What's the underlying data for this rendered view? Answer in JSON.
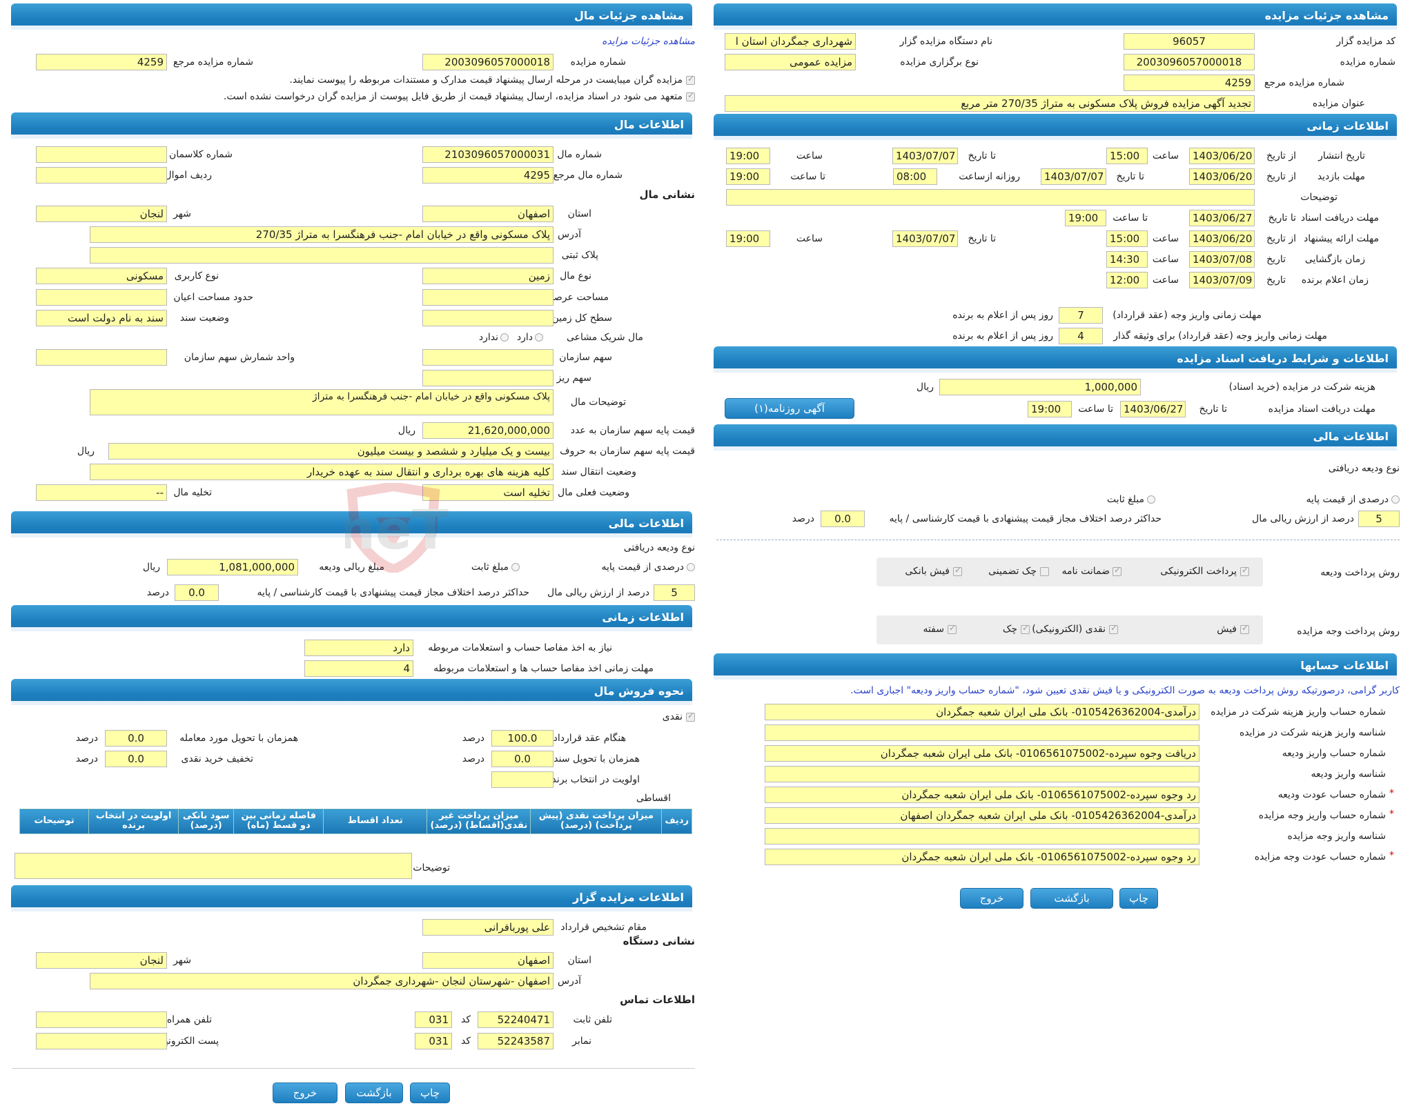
{
  "right": {
    "title": "مشاهده جزئیات مزایده",
    "fields": {
      "auctioneer_code_label": "کد مزایده گزار",
      "auctioneer_code": "96057",
      "auctioneer_name_label": "نام دستگاه مزایده گزار",
      "auctioneer_name": "شهرداری جمگردان استان ا",
      "auction_no_label": "شماره مزایده",
      "auction_no": "2003096057000018",
      "holding_type_label": "نوع برگزاری مزایده",
      "holding_type": "مزایده عمومی",
      "ref_no_label": "شماره مزایده مرجع",
      "ref_no": "4259",
      "auction_title_label": "عنوان مزایده",
      "auction_title": "تجدید آگهی مزایده فروش پلاک مسکونی به متراژ 270/35 متر مربع"
    },
    "time": {
      "title": "اطلاعات زمانی",
      "publish_label": "تاریخ انتشار",
      "from_date": "از تاریخ",
      "to_date": "تا تاریخ",
      "hour": "ساعت",
      "to_hour": "تا ساعت",
      "publish_from": "1403/06/20",
      "publish_from_time": "15:00",
      "publish_to": "1403/07/07",
      "publish_to_time": "19:00",
      "visit_label": "مهلت بازدید",
      "visit_from": "1403/06/20",
      "visit_to": "1403/07/07",
      "daily_from_label": "روزانه ازساعت",
      "visit_daily_from": "08:00",
      "visit_daily_to": "19:00",
      "desc_label": "توضیحات",
      "desc": "",
      "docs_label": "مهلت دریافت اسناد",
      "docs_to": "1403/06/27",
      "docs_to_time": "19:00",
      "offer_label": "مهلت ارائه پیشنهاد",
      "offer_from": "1403/06/20",
      "offer_from_time": "15:00",
      "offer_to": "1403/07/07",
      "offer_to_time": "19:00",
      "open_label": "زمان بازگشایی",
      "date_label": "تاریخ",
      "open_date": "1403/07/08",
      "open_time": "14:30",
      "winner_label": "زمان اعلام برنده",
      "winner_date": "1403/07/09",
      "winner_time": "12:00",
      "pay_deadline_label": "مهلت زمانی واریز وجه (عقد قرارداد)",
      "pay_deadline": "7",
      "days_after": "روز پس از اعلام به برنده",
      "bond_deadline_label": "مهلت زمانی واریز وجه (عقد قرارداد) برای وثیقه گذار",
      "bond_deadline": "4"
    },
    "docs": {
      "title": "اطلاعات و شرایط دریافت اسناد مزایده",
      "fee_label": "هزینه شرکت در مزایده (خرید اسناد)",
      "fee": "1,000,000",
      "rial": "ریال",
      "deadline_label": "مهلت دریافت اسناد مزایده",
      "to_date": "تا تاریخ",
      "deadline_date": "1403/06/27",
      "to_hour": "تا ساعت",
      "deadline_time": "19:00",
      "newspaper_btn": "آگهی روزنامه(۱)"
    },
    "finance": {
      "title": "اطلاعات مالی",
      "deposit_type_label": "نوع ودیعه دریافتی",
      "percent_opt": "درصدی از قیمت پایه",
      "fixed_opt": "مبلغ ثابت",
      "pct_label": "درصد از ارزش ریالی مال",
      "pct": "5",
      "diff_label": "حداکثر درصد اختلاف مجاز قیمت پیشنهادی با قیمت کارشناسی / پایه",
      "diff": "0.0",
      "percent_word": "درصد",
      "deposit_pay_label": "روش پرداخت ودیعه",
      "deposit_methods": [
        "پرداخت الکترونیکی",
        "ضمانت نامه",
        "چک تضمینی",
        "فیش بانکی"
      ],
      "price_pay_label": "روش پرداخت وجه مزایده",
      "price_methods": [
        "فیش",
        "نقدی (الکترونیکی)",
        "چک",
        "سفته"
      ]
    },
    "accounts": {
      "title": "اطلاعات حسابها",
      "note": "کاربر گرامی، درصورتیکه روش پرداخت ودیعه به صورت الکترونیکی و یا فیش نقدی تعیین شود، \"شماره حساب واریز ودیعه\" اجباری است.",
      "rows": [
        {
          "label": "شماره حساب واریز هزینه شرکت در مزایده",
          "value": "درآمدی-0105426362004- بانک ملی ایران شعبه جمگردان",
          "req": ""
        },
        {
          "label": "شناسه واریز هزینه شرکت در مزایده",
          "value": "",
          "req": ""
        },
        {
          "label": "شماره حساب واریز ودیعه",
          "value": "دریافت وجوه سپرده-0106561075002- بانک ملی ایران شعبه جمگردان",
          "req": ""
        },
        {
          "label": "شناسه واریز ودیعه",
          "value": "",
          "req": ""
        },
        {
          "label": "شماره حساب عودت ودیعه",
          "value": "رد وجوه سپرده-0106561075002- بانک ملی ایران شعبه جمگردان",
          "req": "*"
        },
        {
          "label": "شماره حساب واریز وجه مزایده",
          "value": "درآمدی-0105426362004- بانک ملی ایران شعبه جمگردان اصفهان",
          "req": "*"
        },
        {
          "label": "شناسه واریز وجه مزایده",
          "value": "",
          "req": ""
        },
        {
          "label": "شماره حساب عودت وجه مزایده",
          "value": "رد وجوه سپرده-0106561075002- بانک ملی ایران شعبه جمگردان",
          "req": "*"
        }
      ]
    },
    "buttons": {
      "print": "چاپ",
      "back": "بازگشت",
      "exit": "خروج"
    }
  },
  "left": {
    "title": "مشاهده جزئیات مال",
    "link": "مشاهده جزئیات مزایده",
    "auction_no_label": "شماره مزایده",
    "auction_no": "2003096057000018",
    "ref_no_label": "شماره مزایده مرجع",
    "ref_no": "4259",
    "check1": "مزایده گران میبایست در مرحله ارسال پیشنهاد قیمت مدارک و مستندات مربوطه را پیوست نمایند.",
    "check2": "متعهد می شود در اسناد مزایده، ارسال پیشنهاد قیمت از طریق فایل پیوست از مزایده گران درخواست نشده است.",
    "asset": {
      "title": "اطلاعات مال",
      "asset_no_label": "شماره مال",
      "asset_no": "2103096057000031",
      "class_no_label": "شماره کلاسمان",
      "class_no": "",
      "ref_asset_label": "شماره مال مرجع",
      "ref_asset": "4295",
      "row_label": "ردیف اموال",
      "row": "",
      "address_head": "نشانی مال",
      "province_label": "استان",
      "province": "اصفهان",
      "city_label": "شهر",
      "city": "لنجان",
      "address_label": "آدرس",
      "address": "پلاک مسکونی واقع در خیابان امام -جنب فرهنگسرا به متراژ 270/35",
      "plate_label": "پلاک ثبتی",
      "plate": "",
      "type_label": "نوع مال",
      "type": "زمین",
      "use_label": "نوع کاربری",
      "use": "مسکونی",
      "area_label": "مساحت عرصه",
      "area": "",
      "building_label": "حدود مساحت اعیان",
      "building": "",
      "level_label": "سطح کل زمین",
      "level": "",
      "deed_label": "وضعیت سند",
      "deed": "سند به نام دولت است",
      "share_label": "مال شریک مشاعی",
      "yes": "دارد",
      "no": "ندارد",
      "org_share_label": "سهم سازمان",
      "org_share": "",
      "unit_label": "واحد شمارش سهم سازمان",
      "unit": "",
      "small_share_label": "سهم ریز",
      "small_share": "",
      "desc_label": "توضیحات مال",
      "desc": "پلاک مسکونی واقع در خیابان امام -جنب فرهنگسرا به متراژ",
      "base_num_label": "قیمت پایه سهم سازمان به عدد",
      "base_num": "21,620,000,000",
      "rial": "ریال",
      "base_txt_label": "قیمت پایه سهم سازمان به حروف",
      "base_txt": "بیست و یک میلیارد و ششصد و بیست میلیون",
      "transfer_label": "وضعیت انتقال سند",
      "transfer": "کلیه هزینه های بهره برداری و انتقال سند به عهده خریدار",
      "status_label": "وضعیت فعلی مال",
      "status": "تخلیه است",
      "evac_label": "تخلیه مال",
      "evac": "--"
    },
    "finance": {
      "title": "اطلاعات مالی",
      "deposit_type_label": "نوع ودیعه دریافتی",
      "percent_opt": "درصدی از قیمت پایه",
      "fixed_opt": "مبلغ ثابت",
      "amount_label": "مبلغ ریالی ودیعه",
      "amount": "1,081,000,000",
      "rial": "ریال",
      "pct_label": "درصد از ارزش ریالی مال",
      "pct": "5",
      "diff_label": "حداکثر درصد اختلاف مجاز قیمت پیشنهادی با قیمت کارشناسی / پایه",
      "diff": "0.0",
      "percent_word": "درصد"
    },
    "time": {
      "title": "اطلاعات زمانی",
      "need_label": "نیاز به اخذ مفاصا حساب و استعلامات مربوطه",
      "need": "دارد",
      "deadline_label": "مهلت زمانی اخذ مفاصا حساب ها و استعلامات مربوطه",
      "deadline": "4"
    },
    "sale": {
      "title": "نحوه فروش مال",
      "cash_label": "نقدی",
      "contract_label": "هنگام عقد قرارداد",
      "contract": "100.0",
      "deed_label": "همزمان با تحویل سند",
      "deed": "0.0",
      "winner_label": "اولویت در انتخاب برنده",
      "winner": "",
      "delivery_label": "همزمان با تحویل مورد معامله",
      "delivery": "0.0",
      "discount_label": "تخفیف خرید نقدی",
      "discount": "0.0",
      "percent_word": "درصد",
      "install_label": "اقساطی",
      "table_headers": [
        "ردیف",
        "میزان پرداخت نقدی (پیش پرداخت) (درصد)",
        "میزان پرداخت غیر نقدی(اقساط) (درصد)",
        "تعداد اقساط",
        "فاصله زمانی بین دو قسط (ماه)",
        "سود بانکی (درصد)",
        "اولویت در انتخاب برنده",
        "توضیحات"
      ],
      "desc_label": "توضیحات",
      "desc": ""
    },
    "auctioneer": {
      "title": "اطلاعات مزایده گزار",
      "authority_label": "مقام تشخیص قرارداد",
      "authority": "علی پوربافرانی",
      "address_head": "نشانی دستگاه",
      "province_label": "استان",
      "province": "اصفهان",
      "city_label": "شهر",
      "city": "لنجان",
      "address_label": "آدرس",
      "address": "اصفهان -شهرستان لنجان -شهرداری جمگردان",
      "contact_head": "اطلاعات تماس",
      "phone_label": "تلفن ثابت",
      "phone": "52240471",
      "code_label": "کد",
      "phone_code": "031",
      "mobile_label": "تلفن همراه",
      "mobile": "",
      "fax_label": "نمابر",
      "fax": "52243587",
      "fax_code": "031",
      "email_label": "پست الکترونیکی",
      "email": ""
    },
    "buttons": {
      "print": "چاپ",
      "back": "بازگشت",
      "exit": "خروج"
    }
  },
  "watermark_text": "AriaTender.neT"
}
